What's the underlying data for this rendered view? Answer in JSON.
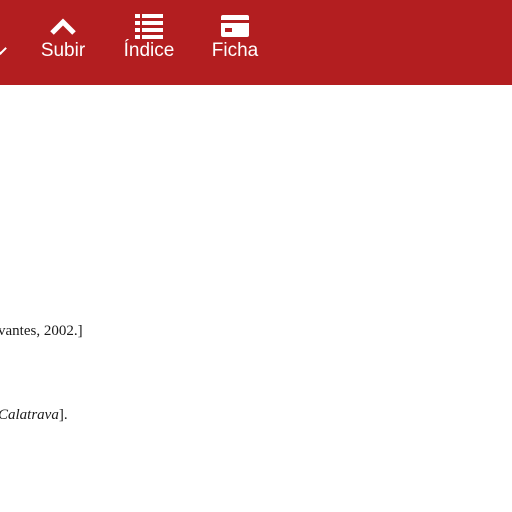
{
  "toolbar": {
    "background_color": "#b31e20",
    "buttons": [
      {
        "id": "subir",
        "label": "Subir",
        "icon": "chevron-up-icon"
      },
      {
        "id": "indice",
        "label": "Índice",
        "icon": "list-icon"
      },
      {
        "id": "ficha",
        "label": "Ficha",
        "icon": "card-icon"
      }
    ]
  },
  "content": {
    "line1": "vantes, 2002.]",
    "line2_italic": "Calatrava",
    "line2_tail": "]."
  }
}
